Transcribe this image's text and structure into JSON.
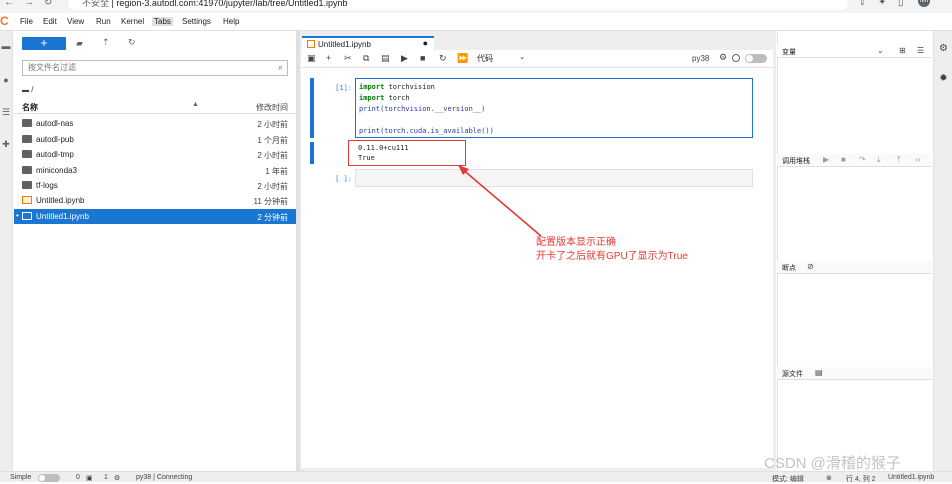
{
  "browser": {
    "url_insecure": "不安全",
    "url": "region-3.autodl.com:41970/jupyter/lab/tree/Untitled1.ipynb",
    "avatar": "nm"
  },
  "menubar": {
    "logo": "C",
    "items": [
      "File",
      "Edit",
      "View",
      "Run",
      "Kernel",
      "Tabs",
      "Settings",
      "Help"
    ],
    "active": "Tabs"
  },
  "filebrowser": {
    "new_label": "+",
    "filter_placeholder": "按文件名过滤",
    "breadcrumb": "/",
    "col_name": "名称",
    "col_modified": "修改时间",
    "files": [
      {
        "name": "autodl-nas",
        "type": "folder",
        "modified": "2 小时前",
        "selected": false
      },
      {
        "name": "autodl-pub",
        "type": "folder",
        "modified": "1 个月前",
        "selected": false
      },
      {
        "name": "autodl-tmp",
        "type": "folder",
        "modified": "2 小时前",
        "selected": false
      },
      {
        "name": "miniconda3",
        "type": "folder",
        "modified": "1 年前",
        "selected": false
      },
      {
        "name": "tf-logs",
        "type": "folder",
        "modified": "2 小时前",
        "selected": false
      },
      {
        "name": "Untitled.ipynb",
        "type": "notebook",
        "modified": "11 分钟前",
        "selected": false
      },
      {
        "name": "Untitled1.ipynb",
        "type": "notebook",
        "modified": "2 分钟前",
        "selected": true
      }
    ]
  },
  "notebook": {
    "tab_label": "Untitled1.ipynb",
    "cell_type": "代码",
    "kernel": "py38",
    "cells": [
      {
        "prompt": "[1]:",
        "code": [
          "import torchvision",
          "import torch",
          "print(torchvision.__version__)",
          "",
          "print(torch.cuda.is_available())"
        ],
        "output": [
          "0.11.0+cu111",
          "True"
        ]
      },
      {
        "prompt": "[ ]:",
        "code": [],
        "output": []
      }
    ]
  },
  "annotation": {
    "line1": "配置版本显示正确",
    "line2": "开卡了之后就有GPU了显示为True",
    "color": "#e53935"
  },
  "right_panel": {
    "variables": "变量",
    "callstack": "调用堆栈",
    "breakpoints": "断点",
    "source": "源文件"
  },
  "statusbar": {
    "mode": "Simple",
    "terminals": "0",
    "kernels": "1",
    "kernel_status": "py38 | Connecting",
    "edit_mode": "模式: 编辑",
    "cursor": "行 4, 列 2",
    "filename": "Untitled1.ipynb"
  },
  "watermark": "CSDN @滑稽的猴子",
  "accent_color": "#1976d2"
}
